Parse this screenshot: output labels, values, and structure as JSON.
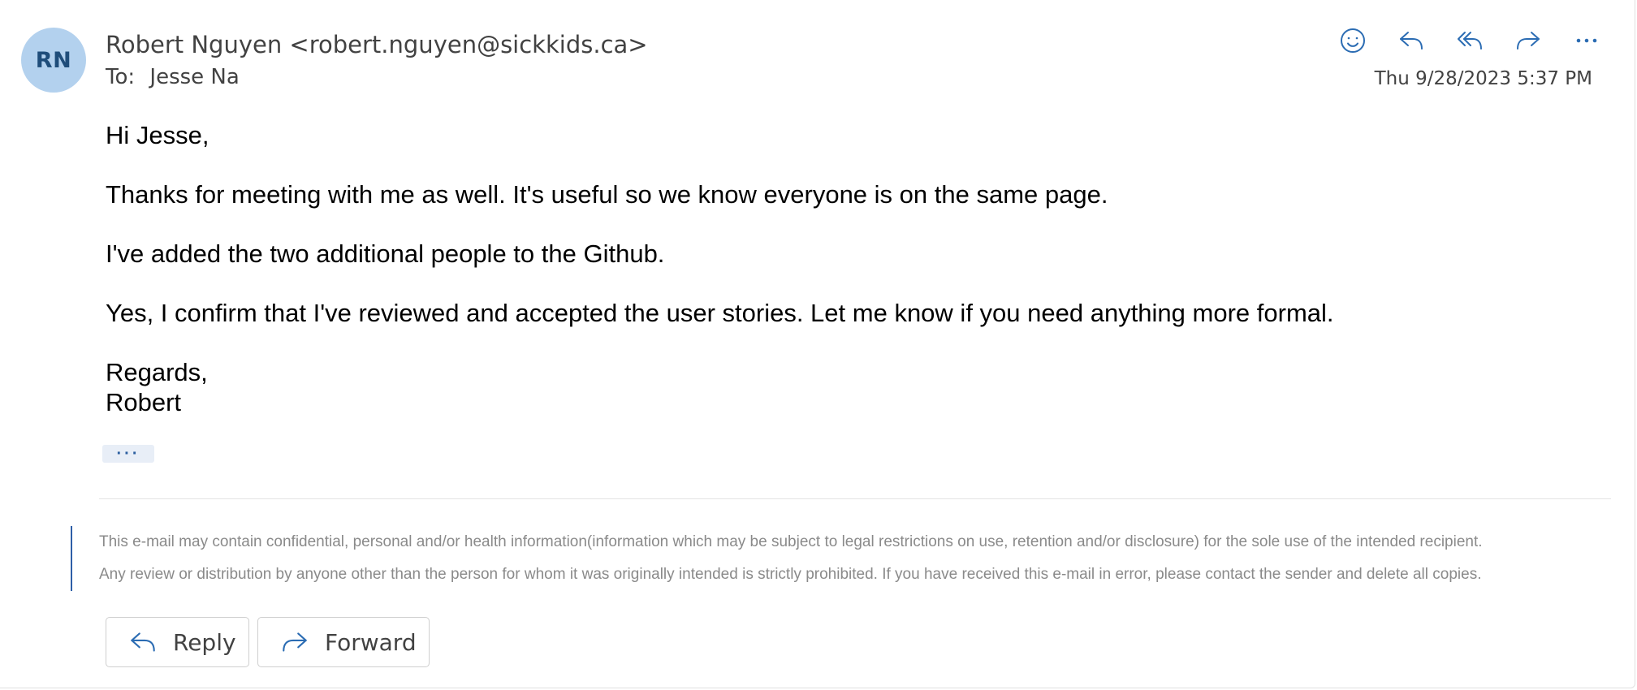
{
  "message": {
    "avatar_initials": "RN",
    "sender": "Robert Nguyen <robert.nguyen@sickkids.ca>",
    "to_label": "To:",
    "to_name": "Jesse Na",
    "timestamp": "Thu 9/28/2023 5:37 PM",
    "body": {
      "greeting": "Hi Jesse,",
      "paragraph_1": "Thanks for meeting with me as well. It's useful so we know everyone is on the same page.",
      "paragraph_2": "I've added the two additional people to the Github.",
      "paragraph_3": "Yes, I confirm that I've reviewed and accepted the user stories. Let me know if you need anything more formal.",
      "closing": "Regards,",
      "signature": "Robert"
    },
    "expand_label": "···",
    "disclaimer": {
      "line_1": "This e-mail may contain confidential, personal and/or health information(information which may be subject to legal restrictions on use, retention and/or disclosure) for the sole use of the intended recipient.",
      "line_2": "Any review or distribution by anyone other than the person for whom it was originally intended is strictly prohibited. If you have received this e-mail in error, please contact the sender and delete all copies."
    }
  },
  "toolbar_icons": [
    "emoji-icon",
    "reply-icon",
    "reply-all-icon",
    "forward-icon",
    "more-icon"
  ],
  "buttons": {
    "reply_label": "Reply",
    "forward_label": "Forward"
  },
  "colors": {
    "accent": "#2b6cb3",
    "avatar_bg": "#b3d1ee",
    "avatar_text": "#1f4d7a",
    "disclaimer_bar": "#2e5fa8"
  }
}
